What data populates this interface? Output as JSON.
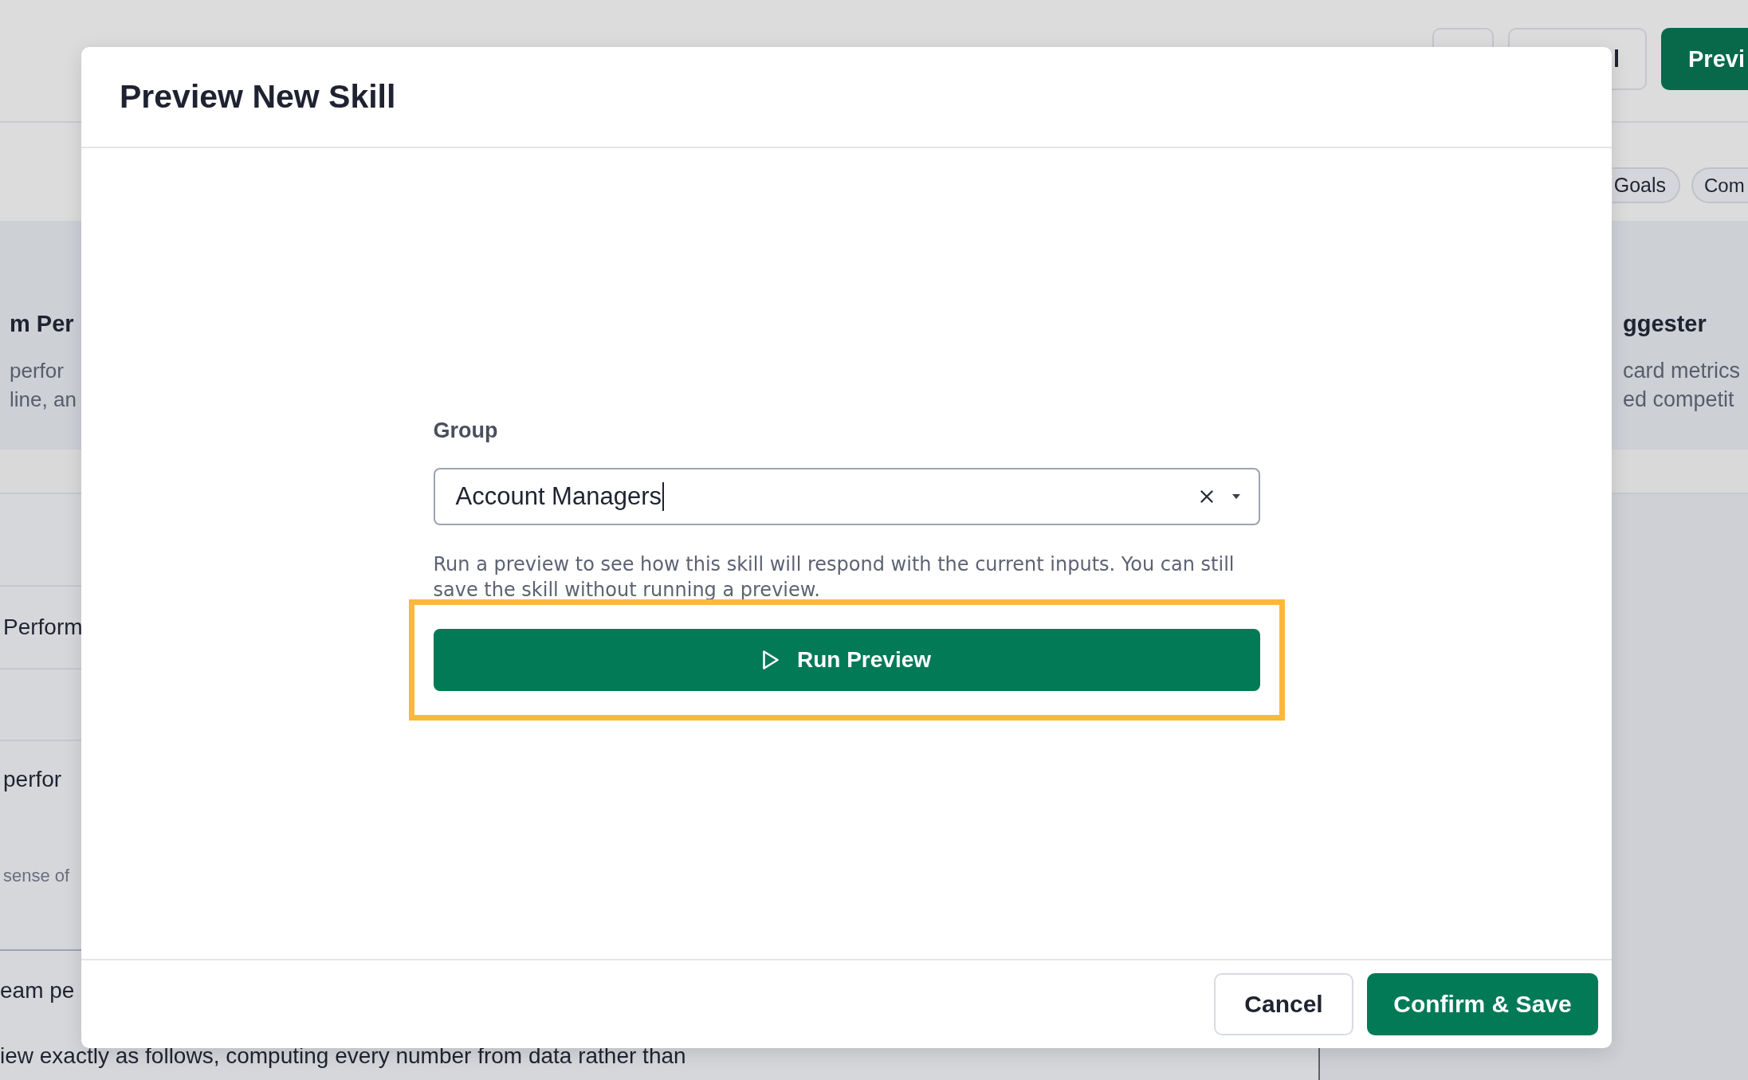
{
  "background_page": {
    "header_buttons": [
      {
        "kind": "outline"
      },
      {
        "kind": "outline",
        "label": "l"
      },
      {
        "kind": "primary",
        "label": "Previ"
      }
    ],
    "filter_chips": [
      {
        "label": "Goals"
      },
      {
        "label": "Com"
      }
    ],
    "cards": [
      {
        "title": "m Per",
        "lines": [
          "perfor",
          "line, an"
        ]
      },
      {
        "title": "ggester",
        "lines": [
          "card metrics",
          "ed competit"
        ]
      }
    ],
    "rows": [
      {
        "title": "Perform"
      },
      {
        "title": "perfor",
        "note": "sense of"
      },
      {
        "title": "eam pe",
        "body": "iew exactly as follows, computing every number from data rather than"
      }
    ]
  },
  "modal": {
    "title": "Preview New Skill",
    "field": {
      "label": "Group",
      "value": "Account Managers",
      "focused": true
    },
    "help_text": "Run a preview to see how this skill will respond with the current inputs. You can still save the skill without running a preview.",
    "run_button": {
      "label": "Run Preview",
      "highlighted": true
    },
    "footer_buttons": [
      {
        "kind": "secondary",
        "label": "Cancel"
      },
      {
        "kind": "primary",
        "label": "Confirm & Save"
      }
    ]
  }
}
